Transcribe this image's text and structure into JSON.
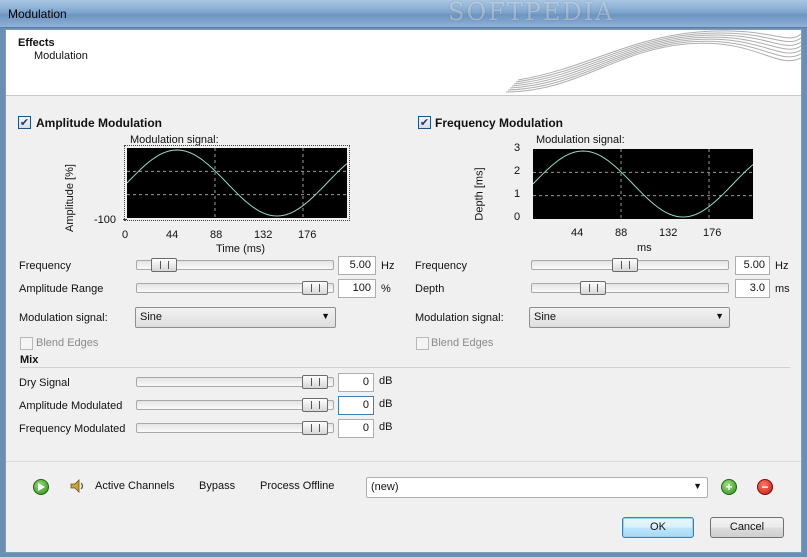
{
  "window": {
    "title": "Modulation",
    "watermark": "SOFTPEDIA"
  },
  "header": {
    "category": "Effects",
    "effect": "Modulation"
  },
  "amplitude": {
    "enabled": true,
    "title": "Amplitude Modulation",
    "chart_title": "Modulation signal:",
    "y_label": "Amplitude [%]",
    "x_label": "Time (ms)",
    "y_tick": "-100",
    "x_ticks": [
      "0",
      "44",
      "88",
      "132",
      "176"
    ],
    "frequency": {
      "label": "Frequency",
      "value": "5.00",
      "unit": "Hz",
      "slider": 0.08
    },
    "range": {
      "label": "Amplitude Range",
      "value": "100",
      "unit": "%",
      "slider": 0.97
    },
    "signal": {
      "label": "Modulation signal:",
      "value": "Sine"
    },
    "blend": {
      "label": "Blend Edges",
      "checked": false
    }
  },
  "frequency_mod": {
    "enabled": true,
    "title": "Frequency Modulation",
    "chart_title": "Modulation signal:",
    "y_label": "Depth [ms]",
    "x_label": "ms",
    "y_ticks": [
      "3",
      "2",
      "1",
      "0"
    ],
    "x_ticks": [
      "44",
      "88",
      "132",
      "176"
    ],
    "frequency": {
      "label": "Frequency",
      "value": "5.00",
      "unit": "Hz",
      "slider": 0.47
    },
    "depth": {
      "label": "Depth",
      "value": "3.0",
      "unit": "ms",
      "slider": 0.28
    },
    "signal": {
      "label": "Modulation signal:",
      "value": "Sine"
    },
    "blend": {
      "label": "Blend Edges",
      "checked": false
    }
  },
  "mix": {
    "title": "Mix",
    "rows": [
      {
        "label": "Dry Signal",
        "value": "0",
        "unit": "dB",
        "slider": 0.97
      },
      {
        "label": "Amplitude Modulated",
        "value": "0",
        "unit": "dB",
        "slider": 0.97
      },
      {
        "label": "Frequency Modulated",
        "value": "0",
        "unit": "dB",
        "slider": 0.97
      }
    ]
  },
  "footer": {
    "active_channels": "Active Channels",
    "bypass": "Bypass",
    "process_offline": "Process Offline",
    "preset": "(new)"
  },
  "buttons": {
    "ok": "OK",
    "cancel": "Cancel"
  },
  "colors": {
    "chart_bg": "#000000",
    "curve": "#8fe0c0",
    "grid": "#9a9a9a",
    "title_bar": "#7fa6cf"
  }
}
